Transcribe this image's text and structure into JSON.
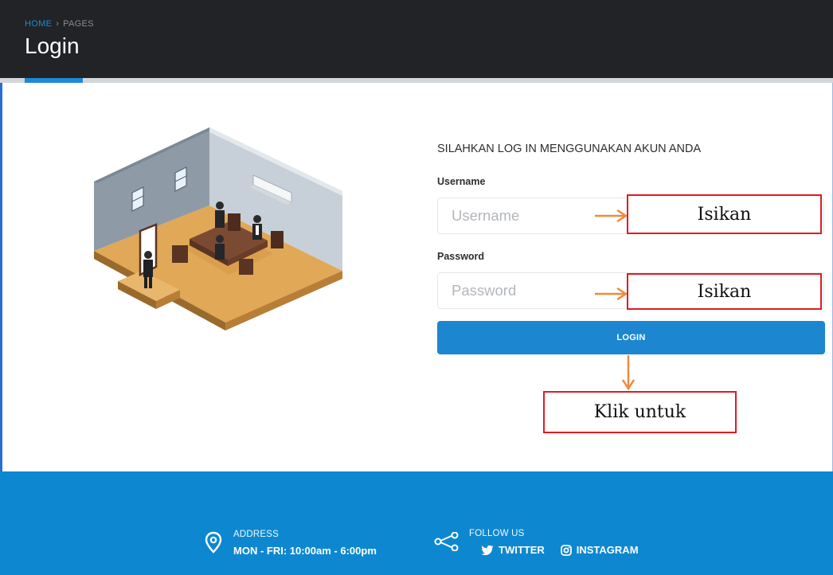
{
  "header": {
    "breadcrumb_home": "HOME",
    "breadcrumb_separator": "›",
    "breadcrumb_pages": "PAGES",
    "title": "Login"
  },
  "form": {
    "heading": "SILAHKAN LOG IN MENGGUNAKAN AKUN ANDA",
    "username_label": "Username",
    "username_placeholder": "Username",
    "password_label": "Password",
    "password_placeholder": "Password",
    "login_button": "LOGIN"
  },
  "annotations": {
    "username_note": "Isikan",
    "password_note": "Isikan",
    "login_note": "Klik untuk"
  },
  "footer": {
    "address_label": "ADDRESS",
    "address_value": "MON - FRI: 10:00am - 6:00pm",
    "follow_label": "FOLLOW US",
    "twitter_label": "TWITTER",
    "instagram_label": "INSTAGRAM"
  },
  "colors": {
    "header_bg": "#212326",
    "accent": "#1e88d6",
    "footer_bg": "#0d88d0",
    "annotation_border": "#e01b22",
    "annotation_arrow": "#f08a3c"
  },
  "icons": [
    "location-pin-icon",
    "share-icon",
    "twitter-icon",
    "instagram-icon"
  ]
}
